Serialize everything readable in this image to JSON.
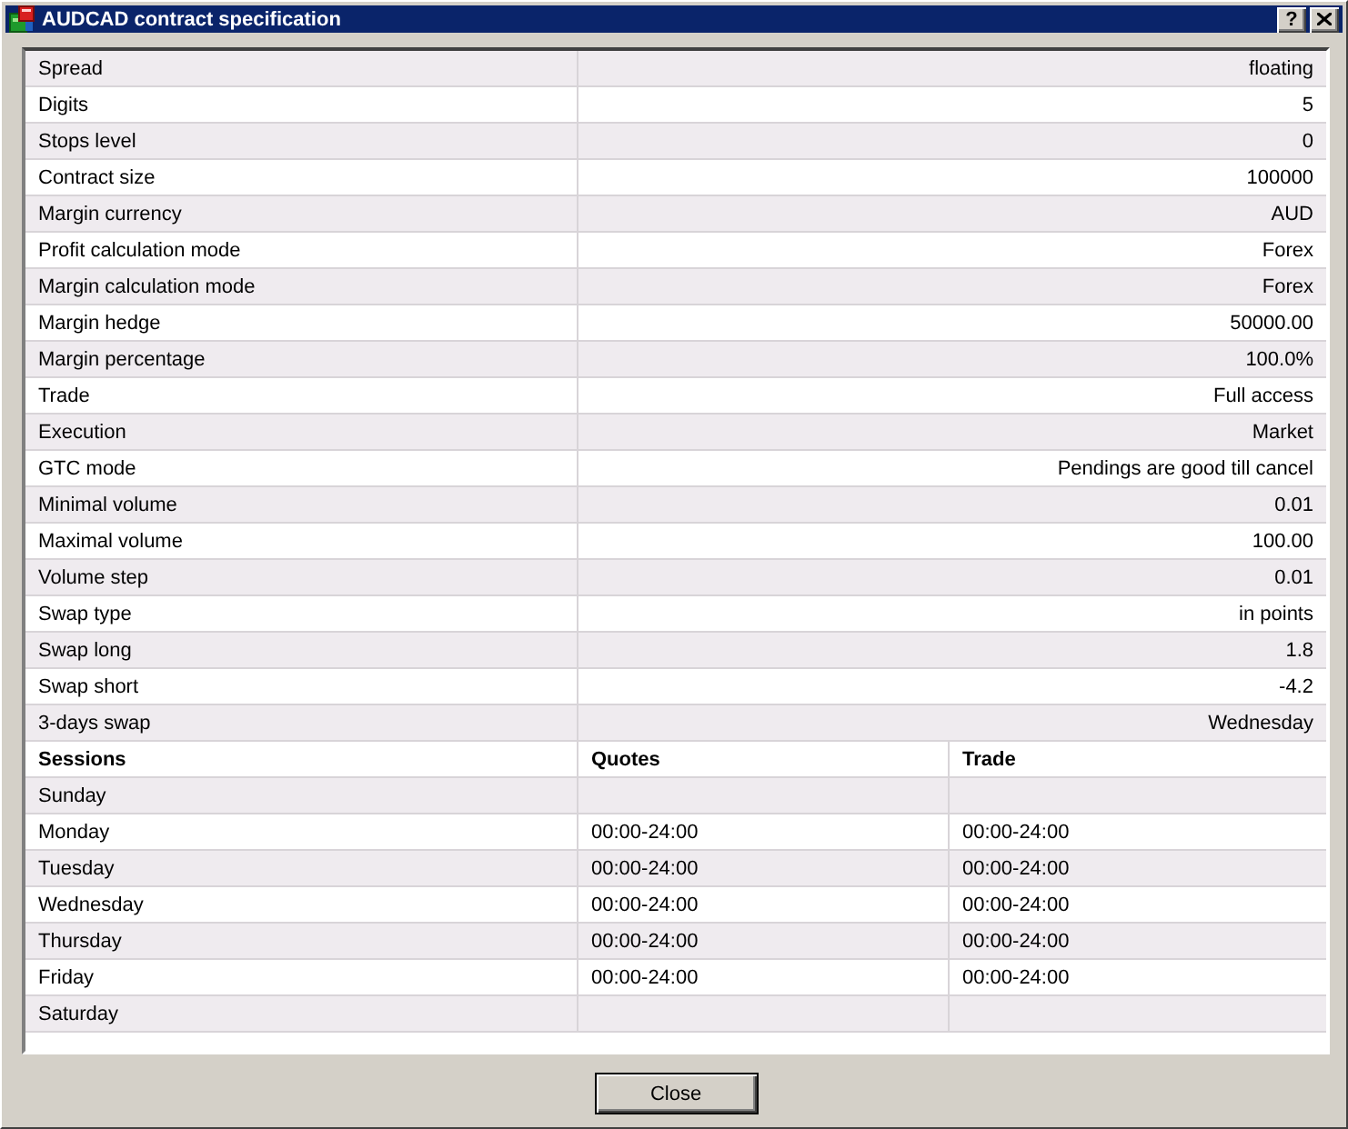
{
  "window": {
    "title": "AUDCAD contract specification",
    "help": "?"
  },
  "specification": [
    {
      "name": "Spread",
      "value": "floating"
    },
    {
      "name": "Digits",
      "value": "5"
    },
    {
      "name": "Stops level",
      "value": "0"
    },
    {
      "name": "Contract size",
      "value": "100000"
    },
    {
      "name": "Margin currency",
      "value": "AUD"
    },
    {
      "name": "Profit calculation mode",
      "value": "Forex"
    },
    {
      "name": "Margin calculation mode",
      "value": "Forex"
    },
    {
      "name": "Margin hedge",
      "value": "50000.00"
    },
    {
      "name": "Margin percentage",
      "value": "100.0%"
    },
    {
      "name": "Trade",
      "value": "Full access"
    },
    {
      "name": "Execution",
      "value": "Market"
    },
    {
      "name": "GTC mode",
      "value": "Pendings are good till cancel"
    },
    {
      "name": "Minimal volume",
      "value": "0.01"
    },
    {
      "name": "Maximal volume",
      "value": "100.00"
    },
    {
      "name": "Volume step",
      "value": "0.01"
    },
    {
      "name": "Swap type",
      "value": "in points"
    },
    {
      "name": "Swap long",
      "value": "1.8"
    },
    {
      "name": "Swap short",
      "value": "-4.2"
    },
    {
      "name": "3-days swap",
      "value": "Wednesday"
    }
  ],
  "sessions": {
    "columns": [
      "Sessions",
      "Quotes",
      "Trade"
    ],
    "rows": [
      {
        "day": "Sunday"
      },
      {
        "day": "Monday",
        "quotes": "00:00-24:00",
        "trade": "00:00-24:00"
      },
      {
        "day": "Tuesday",
        "quotes": "00:00-24:00",
        "trade": "00:00-24:00"
      },
      {
        "day": "Wednesday",
        "quotes": "00:00-24:00",
        "trade": "00:00-24:00"
      },
      {
        "day": "Thursday",
        "quotes": "00:00-24:00",
        "trade": "00:00-24:00"
      },
      {
        "day": "Friday",
        "quotes": "00:00-24:00",
        "trade": "00:00-24:00"
      },
      {
        "day": "Saturday"
      }
    ]
  },
  "buttons": [
    "Close"
  ]
}
